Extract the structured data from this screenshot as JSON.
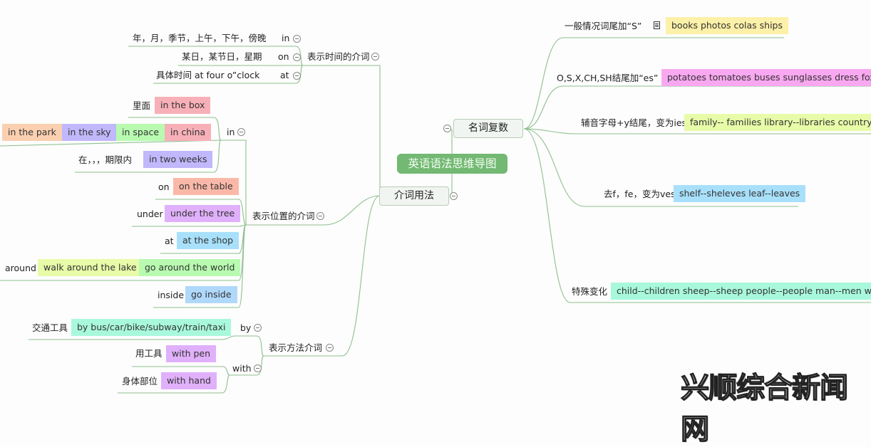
{
  "central_topic": "英语语法思维导图",
  "colors": {
    "line": "#8fbf8f",
    "central_bg": "#73b873",
    "yellow": "#fdf0a8",
    "pink": "#f8a8f0",
    "lime": "#e8fba8",
    "skyblue": "#a8e0fb",
    "mint": "#a8f8dc",
    "rose": "#f8b0b8",
    "peach": "#fbd0b0",
    "lavender": "#c0b8fb",
    "lightgreen": "#b8fbb0",
    "salmon": "#fbb8a8",
    "violet": "#e0b0fb",
    "lightblue": "#b0d8fb"
  },
  "branches": {
    "noun_plural": {
      "label": "名词复数",
      "rules": [
        {
          "rule": "一般情况词尾加“S”",
          "note_icon": "note-icon",
          "examples": "books photos colas ships"
        },
        {
          "rule": "O,S,X,CH,SH结尾加“es”",
          "examples": "potatoes tomatoes buses sunglasses dress foxes s"
        },
        {
          "rule": "辅音字母+y结尾，变为ies",
          "examples": "family-- families library--libraries country--co"
        },
        {
          "rule": "去f，fe，变为ves",
          "examples": "shelf--sheleves leaf--leaves"
        },
        {
          "rule": "特殊变化",
          "examples": "child--children sheep--sheep people--people man--men wom"
        }
      ]
    },
    "prepositions": {
      "label": "介词用法",
      "time": {
        "label": "表示时间的介词",
        "items": [
          {
            "prep": "in",
            "desc": "年，月，季节，上午，下午，傍晚"
          },
          {
            "prep": "on",
            "desc": "某日，某节日，星期"
          },
          {
            "prep": "at",
            "desc": "具体时间  at four o”clock"
          }
        ]
      },
      "place": {
        "label": "表示位置的介词",
        "in": {
          "prep": "in",
          "rows": [
            {
              "desc": "里面",
              "examples": [
                "in the box"
              ]
            },
            {
              "desc": "",
              "examples": [
                "in the park",
                "in the sky",
                "in space",
                "in china"
              ]
            },
            {
              "desc": "在，，，期限内",
              "examples": [
                "in two weeks"
              ]
            }
          ]
        },
        "others": [
          {
            "prep": "on",
            "examples": [
              "on the table"
            ]
          },
          {
            "prep": "under",
            "examples": [
              "under the tree"
            ]
          },
          {
            "prep": "at",
            "examples": [
              "at the shop"
            ]
          },
          {
            "prep": "around",
            "examples": [
              "walk around the lake",
              "go around the world"
            ]
          },
          {
            "prep": "inside",
            "examples": [
              "go inside"
            ]
          }
        ]
      },
      "method": {
        "label": "表示方法介词",
        "by": {
          "prep": "by",
          "desc": "交通工具",
          "example": "by bus/car/bike/subway/train/taxi"
        },
        "with": {
          "prep": "with",
          "rows": [
            {
              "desc": "用工具",
              "example": "with pen"
            },
            {
              "desc": "身体部位",
              "example": "with hand"
            }
          ]
        }
      }
    }
  },
  "watermark": "兴顺综合新闻网"
}
